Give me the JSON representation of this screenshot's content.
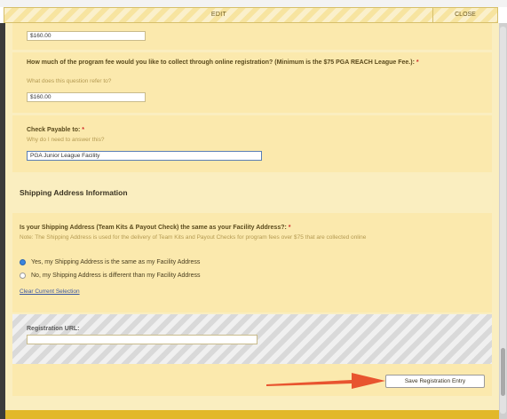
{
  "dialog": {
    "title": "EDIT",
    "close_label": "CLOSE"
  },
  "fields": {
    "top_amount": {
      "value": "$160.00"
    },
    "online_fee": {
      "question": "How much of the program fee would you like to collect through online registration? (Minimum is the $75 PGA REACH League Fee.):",
      "required_mark": "*",
      "hint": "What does this question refer to?",
      "value": "$160.00"
    },
    "check_payable": {
      "question": "Check Payable to:",
      "required_mark": "*",
      "hint": "Why do I need to answer this?",
      "value": "PGA Junior League Facility"
    }
  },
  "shipping": {
    "section_title": "Shipping Address Information",
    "question": "Is your Shipping Address (Team Kits & Payout Check) the same as your Facility Address?:",
    "required_mark": "*",
    "note": "Note: The Shipping Address is used for the delivery of Team Kits and Payout Checks for program fees over $75 that are collected online",
    "options": [
      {
        "label": "Yes, my Shipping Address is the same as my Facility Address",
        "selected": true
      },
      {
        "label": "No, my Shipping Address is different than my Facility Address",
        "selected": false
      }
    ],
    "clear_label": "Clear Current Selection"
  },
  "registration": {
    "url_label": "Registration URL:",
    "url_value": ""
  },
  "actions": {
    "save_label": "Save Registration Entry"
  },
  "colors": {
    "panel": "#faeec0",
    "section": "#fbe9ad",
    "title_bar": "#f7e4a0",
    "radio_selected": "#3a86e0",
    "arrow": "#e8542f",
    "bottom_bar": "#e2b82a"
  }
}
